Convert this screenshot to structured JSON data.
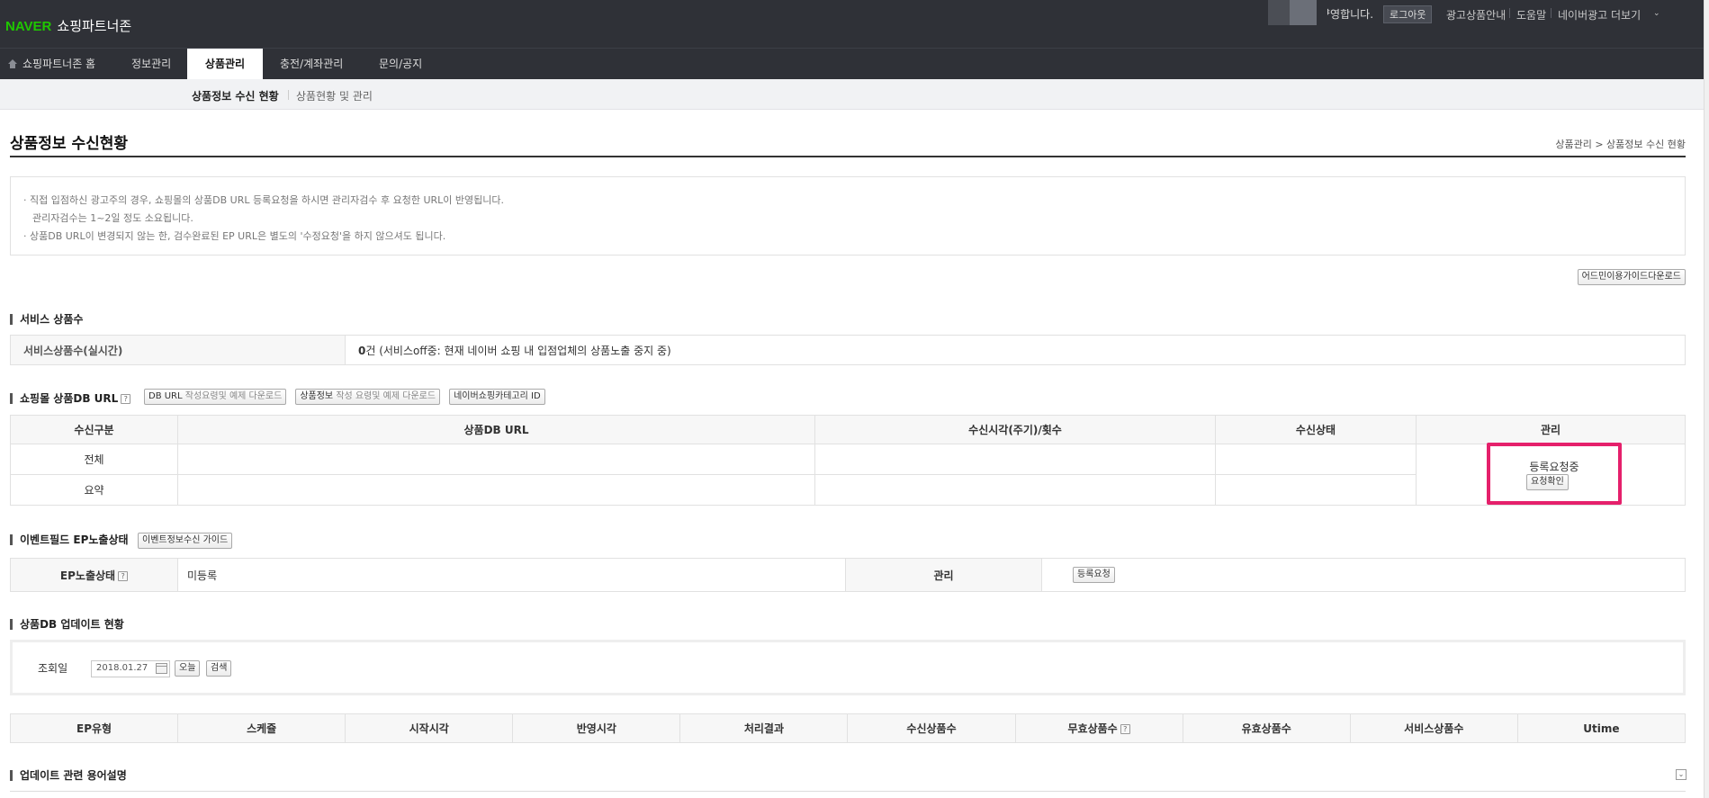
{
  "header": {
    "logo_naver": "NAVER",
    "logo_zone": "쇼핑파트너존",
    "greeting": "ᅣ영합니다.",
    "logout": "로그아웃",
    "links": [
      "광고상품안내",
      "도움말",
      "네이버광고 더보기"
    ]
  },
  "nav": {
    "tabs": [
      "쇼핑파트너존 홈",
      "정보관리",
      "상품관리",
      "충전/계좌관리",
      "문의/공지"
    ],
    "active": "상품관리"
  },
  "subnav": {
    "items": [
      "상품정보 수신 현황",
      "상품현황 및 관리"
    ]
  },
  "page": {
    "title": "상품정보 수신현황",
    "breadcrumb": "상품관리 > 상품정보 수신 현황"
  },
  "notice": {
    "line1": "· 직접 입점하신 광고주의 경우, 쇼핑몰의 상품DB URL 등록요청을 하시면 관리자검수 후 요청한 URL이 반영됩니다.",
    "line2": "관리자검수는 1~2일 정도 소요됩니다.",
    "line3": "· 상품DB URL이 변경되지 않는 한, 검수완료된 EP URL은 별도의 '수정요청'을 하지 않으셔도 됩니다."
  },
  "guide_button": "어드민이용가이드다운로드",
  "service": {
    "title": "서비스 상품수",
    "label": "서비스상품수(실시간)",
    "count": "0",
    "count_suffix": "건 (서비스off중: 현재 네이버 쇼핑 내 입점업체의 상품노출 중지 중)"
  },
  "db_url": {
    "title": "쇼핑몰 상품DB URL",
    "help": "?",
    "btn1_a": "DB URL",
    "btn1_b": "작성요령및 예제 다운로드",
    "btn2_a": "상품정보",
    "btn2_b": "작성 요령및 예제 다운로드",
    "btn3": "네이버쇼핑카테고리 ID",
    "headers": [
      "수신구분",
      "상품DB URL",
      "수신시각(주기)/횟수",
      "수신상태",
      "관리"
    ],
    "rows": [
      {
        "type": "전체"
      },
      {
        "type": "요약"
      }
    ],
    "status_text": "등록요청중",
    "status_button": "요청확인"
  },
  "event": {
    "title": "이벤트필드 EP노출상태",
    "guide_button": "이벤트정보수신 가이드",
    "status_label": "EP노출상태",
    "help": "?",
    "status_value": "미등록",
    "manage_label": "관리",
    "register_button": "등록요청"
  },
  "update": {
    "title": "상품DB 업데이트 현황",
    "date_label": "조회일",
    "date_value": "2018.01.27",
    "today_button": "오늘",
    "search_button": "검색",
    "headers": [
      "EP유형",
      "스케쥴",
      "시작시각",
      "반영시각",
      "처리결과",
      "수신상품수",
      "무효상품수",
      "유효상품수",
      "서비스상품수",
      "Utime"
    ],
    "help": "?"
  },
  "glossary": {
    "title": "업데이트 관련 용어설명",
    "toggle": "⌄"
  }
}
